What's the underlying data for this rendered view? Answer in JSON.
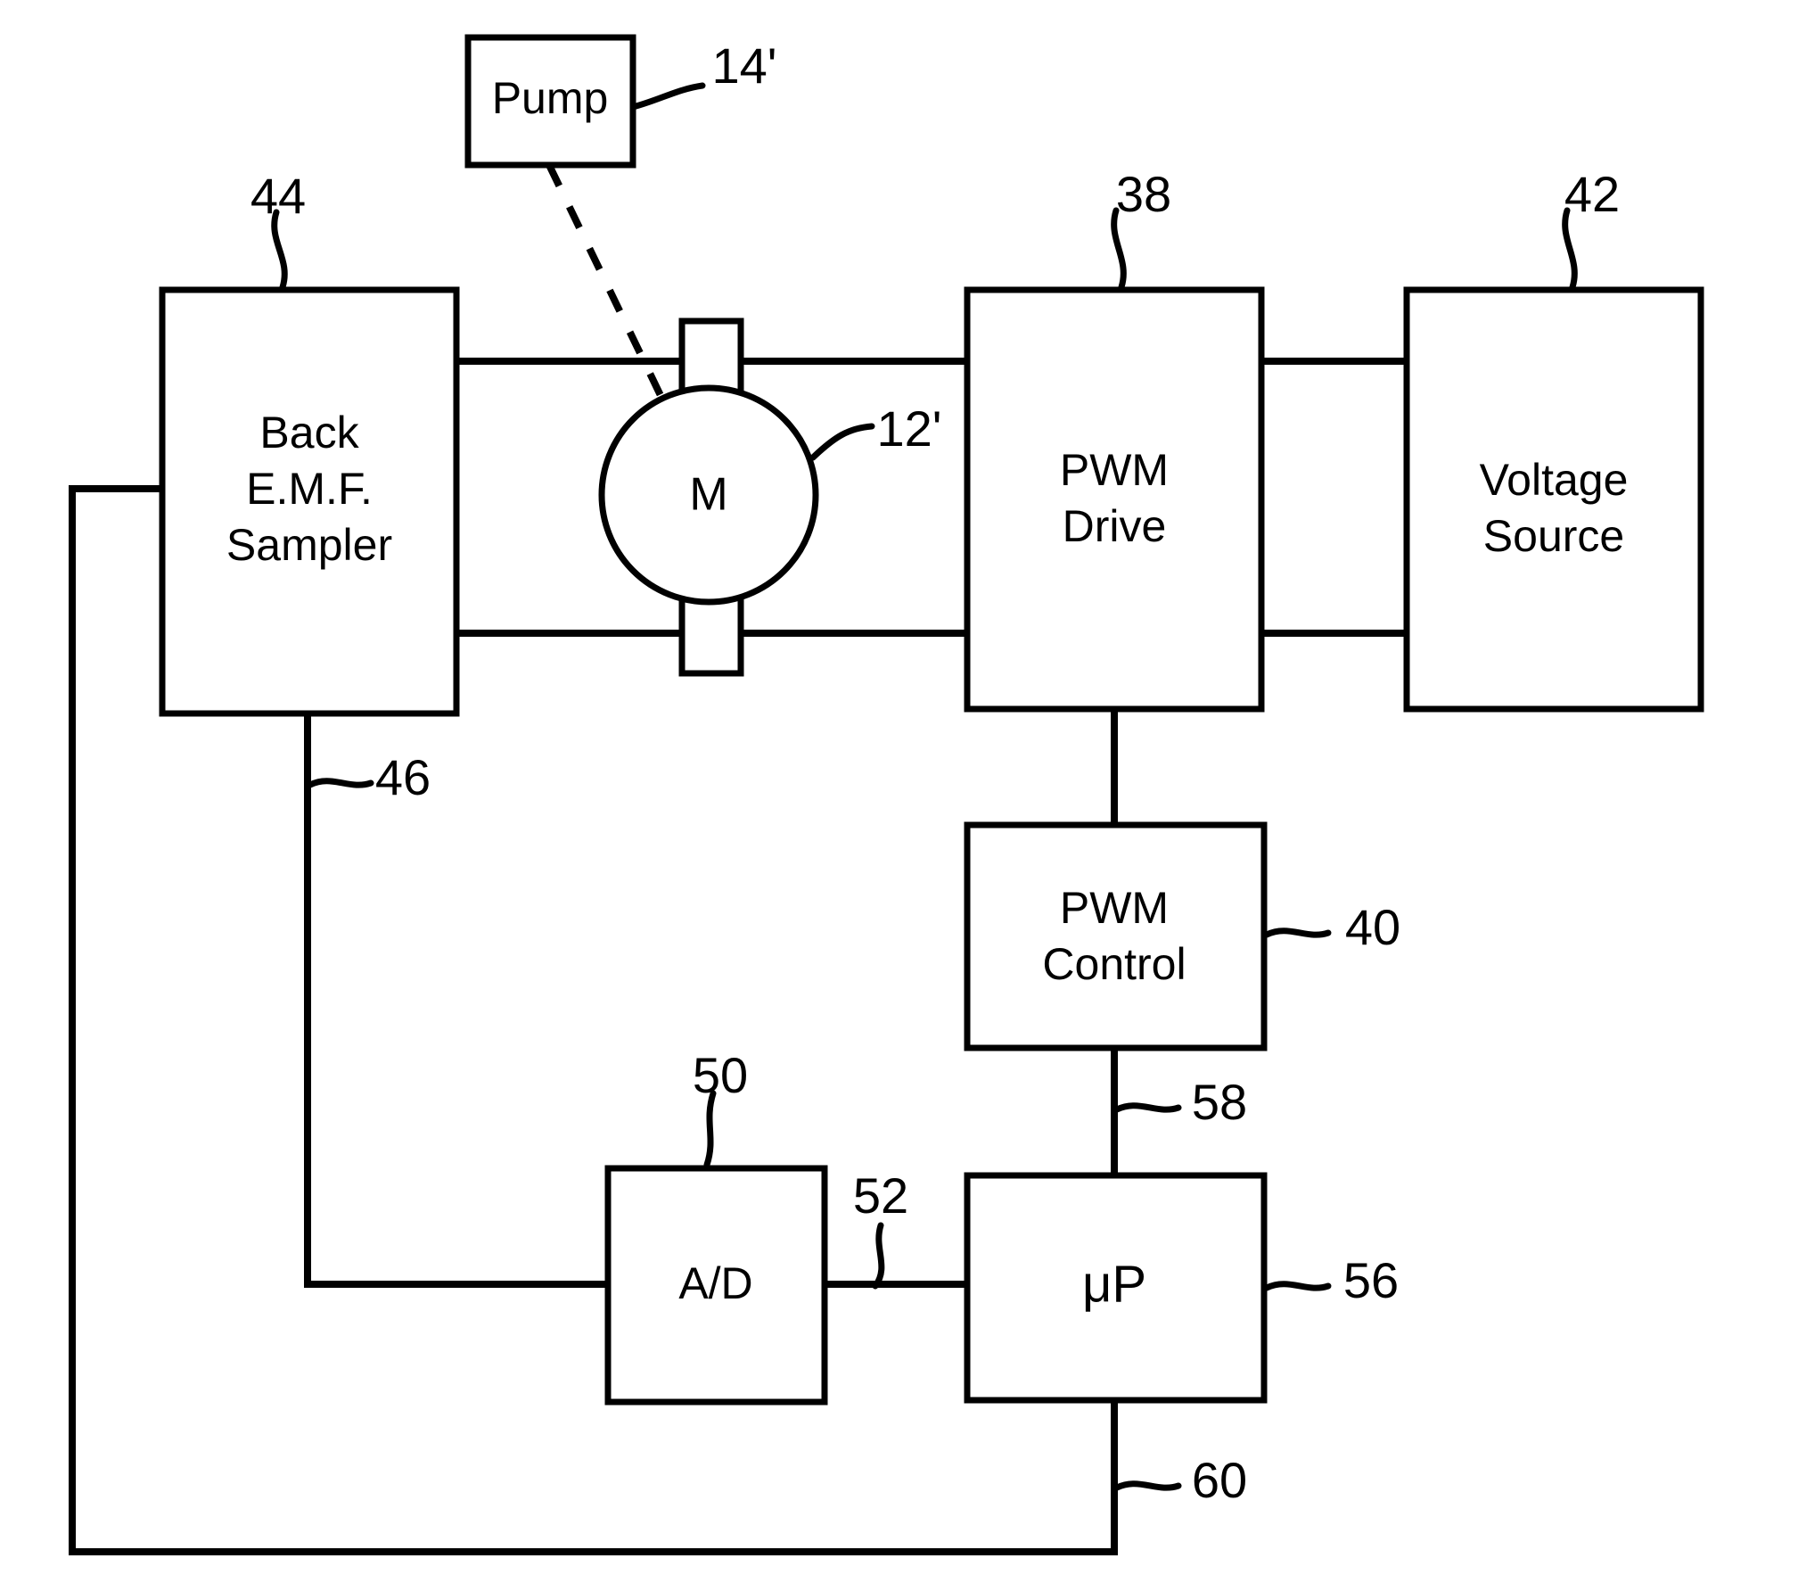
{
  "figure": {
    "type": "patent-block-diagram",
    "subject": "Back EMF sampled PWM motor speed control for a pump"
  },
  "blocks": [
    {
      "id": "pump",
      "label_lines": [
        "Pump"
      ],
      "ref": "14'",
      "shape": "rectangle"
    },
    {
      "id": "back_emf_sampler",
      "label_lines": [
        "Back",
        "E.M.F.",
        "Sampler"
      ],
      "ref": "44",
      "shape": "rectangle"
    },
    {
      "id": "motor",
      "label_lines": [
        "M"
      ],
      "ref": "12'",
      "shape": "circle-with-terminals"
    },
    {
      "id": "pwm_drive",
      "label_lines": [
        "PWM",
        "Drive"
      ],
      "ref": "38",
      "shape": "rectangle"
    },
    {
      "id": "voltage_source",
      "label_lines": [
        "Voltage",
        "Source"
      ],
      "ref": "42",
      "shape": "rectangle"
    },
    {
      "id": "pwm_control",
      "label_lines": [
        "PWM",
        "Control"
      ],
      "ref": "40",
      "shape": "rectangle"
    },
    {
      "id": "ad_converter",
      "label_lines": [
        "A/D"
      ],
      "ref": "50",
      "shape": "rectangle"
    },
    {
      "id": "microprocessor",
      "label_lines": [
        "μP"
      ],
      "ref": "56",
      "shape": "rectangle"
    }
  ],
  "labels": {
    "pump": "Pump",
    "back_emf_line1": "Back",
    "back_emf_line2": "E.M.F.",
    "back_emf_line3": "Sampler",
    "motor": "M",
    "pwm_drive_line1": "PWM",
    "pwm_drive_line2": "Drive",
    "voltage_source_line1": "Voltage",
    "voltage_source_line2": "Source",
    "pwm_control_line1": "PWM",
    "pwm_control_line2": "Control",
    "ad_converter": "A/D",
    "microprocessor": "μP"
  },
  "reference_numerals": {
    "pump": "14'",
    "back_emf_sampler": "44",
    "motor": "12'",
    "pwm_drive": "38",
    "voltage_source": "42",
    "back_emf_output_line": "46",
    "pwm_control": "40",
    "ad_converter": "50",
    "ad_to_up_line": "52",
    "pwm_control_to_up_line": "58",
    "microprocessor": "56",
    "up_feedback_line": "60"
  },
  "connections": [
    {
      "from": "back_emf_sampler",
      "to": "motor",
      "note": "upper motor lead"
    },
    {
      "from": "back_emf_sampler",
      "to": "motor",
      "note": "lower motor lead"
    },
    {
      "from": "motor",
      "to": "pwm_drive",
      "note": "upper motor lead"
    },
    {
      "from": "motor",
      "to": "pwm_drive",
      "note": "lower motor lead"
    },
    {
      "from": "pwm_drive",
      "to": "voltage_source",
      "note": "upper supply rail"
    },
    {
      "from": "pwm_drive",
      "to": "voltage_source",
      "note": "lower supply rail"
    },
    {
      "from": "pwm_drive",
      "to": "pwm_control",
      "note": "drive control input"
    },
    {
      "from": "pwm_control",
      "to": "microprocessor",
      "ref": "58"
    },
    {
      "from": "back_emf_sampler",
      "to": "ad_converter",
      "ref": "46"
    },
    {
      "from": "ad_converter",
      "to": "microprocessor",
      "ref": "52"
    },
    {
      "from": "microprocessor",
      "to": "back_emf_sampler",
      "ref": "60"
    },
    {
      "from": "pump",
      "to": "motor",
      "style": "dashed",
      "note": "mechanical coupling"
    }
  ],
  "colors": {
    "ink": "#000000",
    "background": "#ffffff"
  }
}
